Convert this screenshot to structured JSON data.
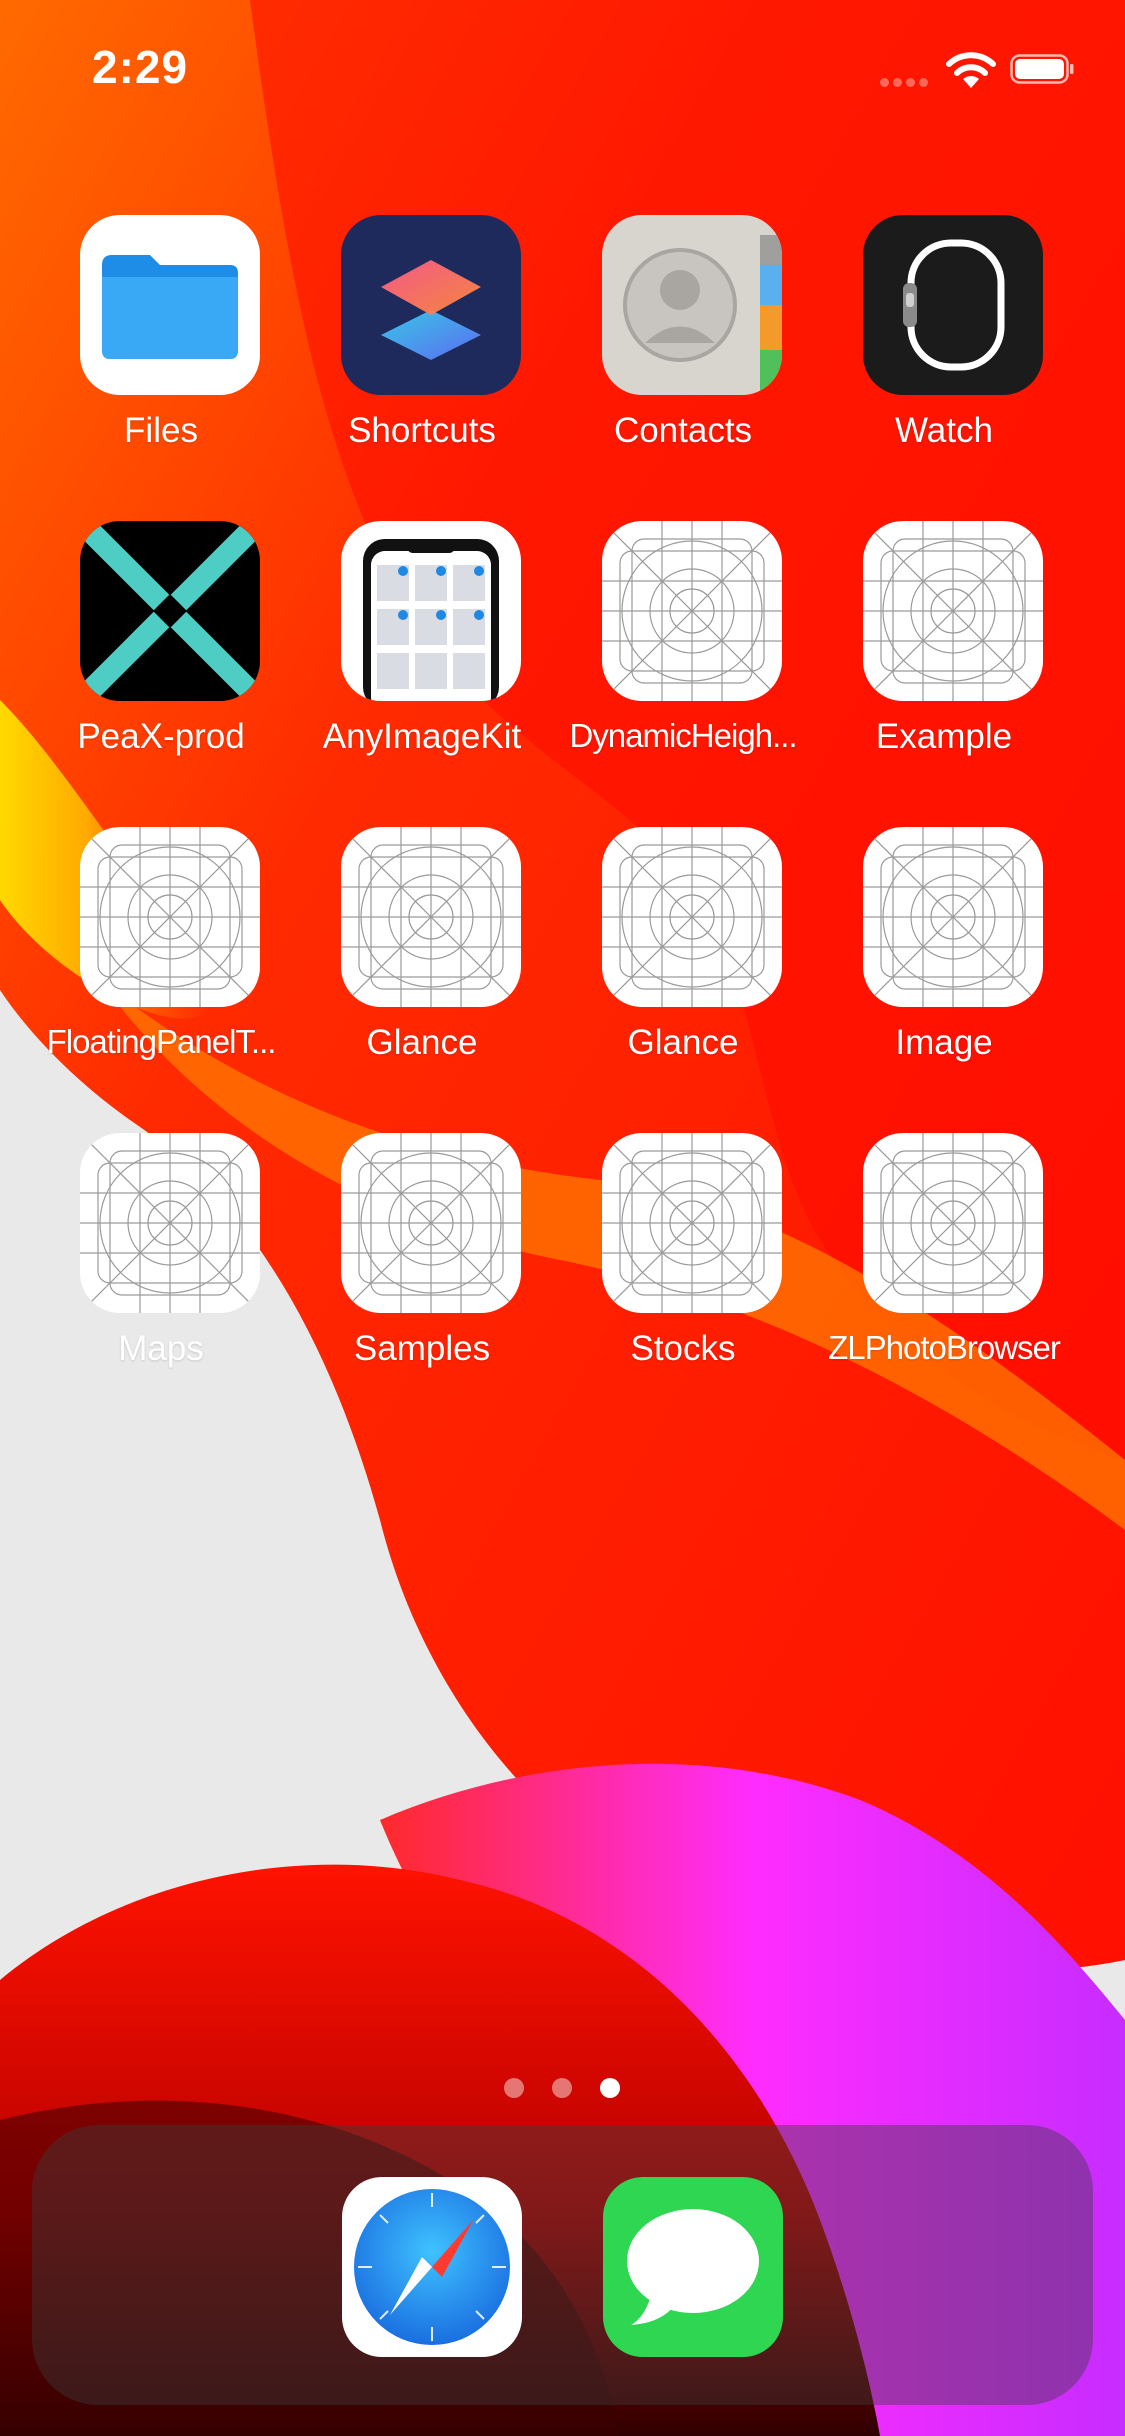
{
  "status_bar": {
    "time": "2:29"
  },
  "apps": [
    {
      "label": "Files",
      "icon": "files-icon"
    },
    {
      "label": "Shortcuts",
      "icon": "shortcuts-icon"
    },
    {
      "label": "Contacts",
      "icon": "contacts-icon"
    },
    {
      "label": "Watch",
      "icon": "watch-icon"
    },
    {
      "label": "PeaX-prod",
      "icon": "peax-icon"
    },
    {
      "label": "AnyImageKit",
      "icon": "anyimagekit-icon"
    },
    {
      "label": "DynamicHeigh...",
      "icon": "placeholder-app-icon"
    },
    {
      "label": "Example",
      "icon": "placeholder-app-icon"
    },
    {
      "label": "FloatingPanelT...",
      "icon": "placeholder-app-icon"
    },
    {
      "label": "Glance",
      "icon": "placeholder-app-icon"
    },
    {
      "label": "Glance",
      "icon": "placeholder-app-icon"
    },
    {
      "label": "Image",
      "icon": "placeholder-app-icon"
    },
    {
      "label": "Maps",
      "icon": "placeholder-app-icon"
    },
    {
      "label": "Samples",
      "icon": "placeholder-app-icon"
    },
    {
      "label": "Stocks",
      "icon": "placeholder-app-icon"
    },
    {
      "label": "ZLPhotoBrowser",
      "icon": "placeholder-app-icon"
    }
  ],
  "page_indicator": {
    "pages": 3,
    "current": 3
  },
  "dock": [
    {
      "icon": "safari-icon"
    },
    {
      "icon": "messages-icon"
    }
  ],
  "colors": {
    "wallpaper_red": "#ff1a00",
    "wallpaper_orange": "#ff5a00",
    "wallpaper_magenta": "#ff2cff",
    "wallpaper_light": "#e8e8e8",
    "files_blue": "#2a9bf2",
    "messages_green": "#2fd651"
  }
}
